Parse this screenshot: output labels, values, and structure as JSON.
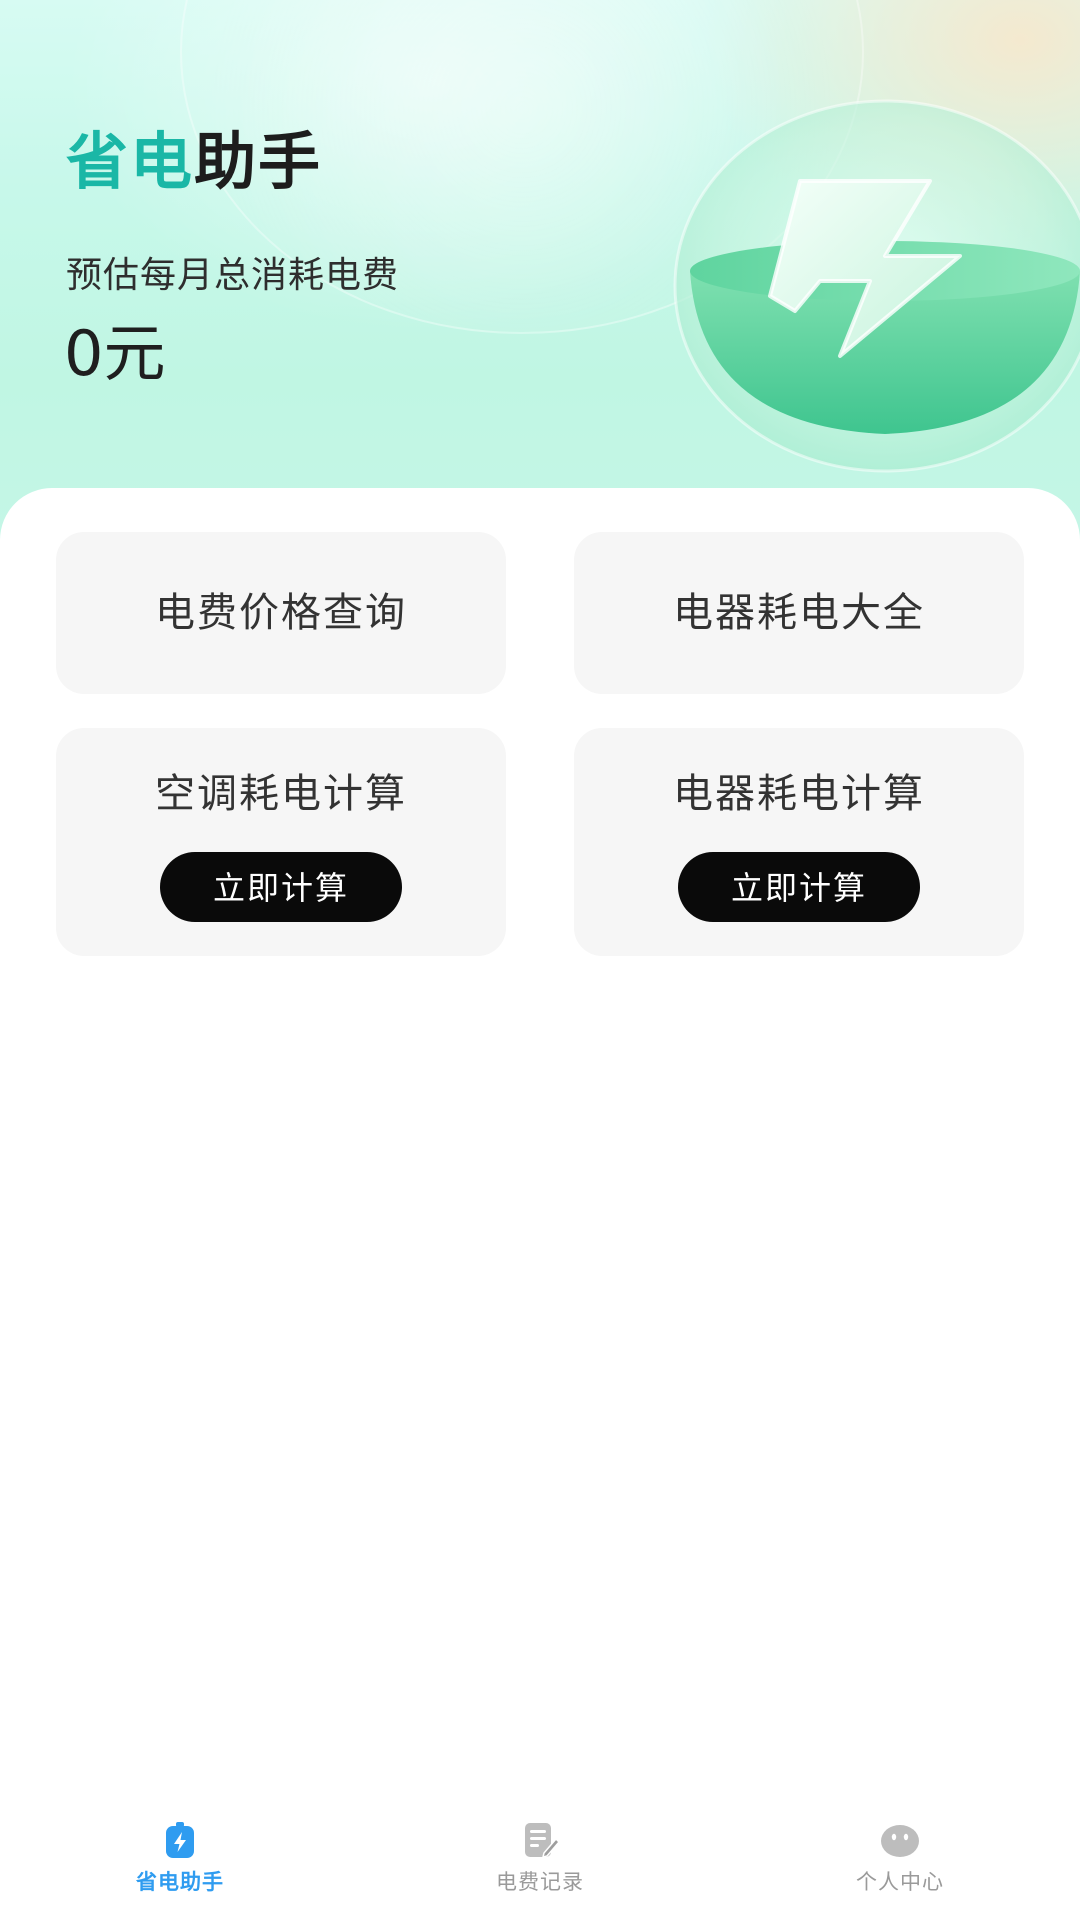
{
  "header": {
    "title_accent": "省电",
    "title_rest": "助手",
    "estimate_label": "预估每月总消耗电费",
    "estimate_value": "0元",
    "illustration_icon": "lightning-bowl-icon"
  },
  "tiles": [
    {
      "title": "电费价格查询"
    },
    {
      "title": "电器耗电大全"
    },
    {
      "title": "空调耗电计算",
      "button": "立即计算"
    },
    {
      "title": "电器耗电计算",
      "button": "立即计算"
    }
  ],
  "tabbar": {
    "items": [
      {
        "label": "省电助手",
        "icon": "battery-bolt-icon",
        "active": true
      },
      {
        "label": "电费记录",
        "icon": "note-edit-icon",
        "active": false
      },
      {
        "label": "个人中心",
        "icon": "face-icon",
        "active": false
      }
    ]
  },
  "colors": {
    "accent": "#1ab7a6",
    "active_tab": "#2f9cf0",
    "button_bg": "#0a0a0a"
  }
}
